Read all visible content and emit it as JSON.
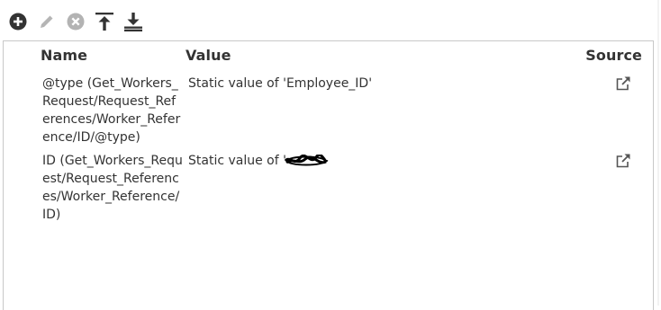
{
  "toolbar": {
    "buttons": [
      {
        "icon": "add-icon"
      },
      {
        "icon": "edit-icon"
      },
      {
        "icon": "remove-icon"
      },
      {
        "icon": "move-to-top-icon"
      },
      {
        "icon": "move-to-bottom-icon"
      }
    ]
  },
  "grid": {
    "columns": {
      "name": "Name",
      "value": "Value",
      "source": "Source"
    },
    "rows": [
      {
        "name": "@type (Get_Workers_Request/Request_References/Worker_Reference/ID/@type)",
        "value": "Static value of 'Employee_ID'",
        "source_icon": "external-link-icon"
      },
      {
        "name": "ID (Get_Workers_Request/Request_References/Worker_Reference/ID)",
        "value": "Static value of '",
        "source_icon": "external-link-icon"
      }
    ]
  },
  "colors": {
    "icon_dark": "#333333",
    "icon_disabled": "#b0b0b0",
    "border": "#c8c8c8"
  }
}
